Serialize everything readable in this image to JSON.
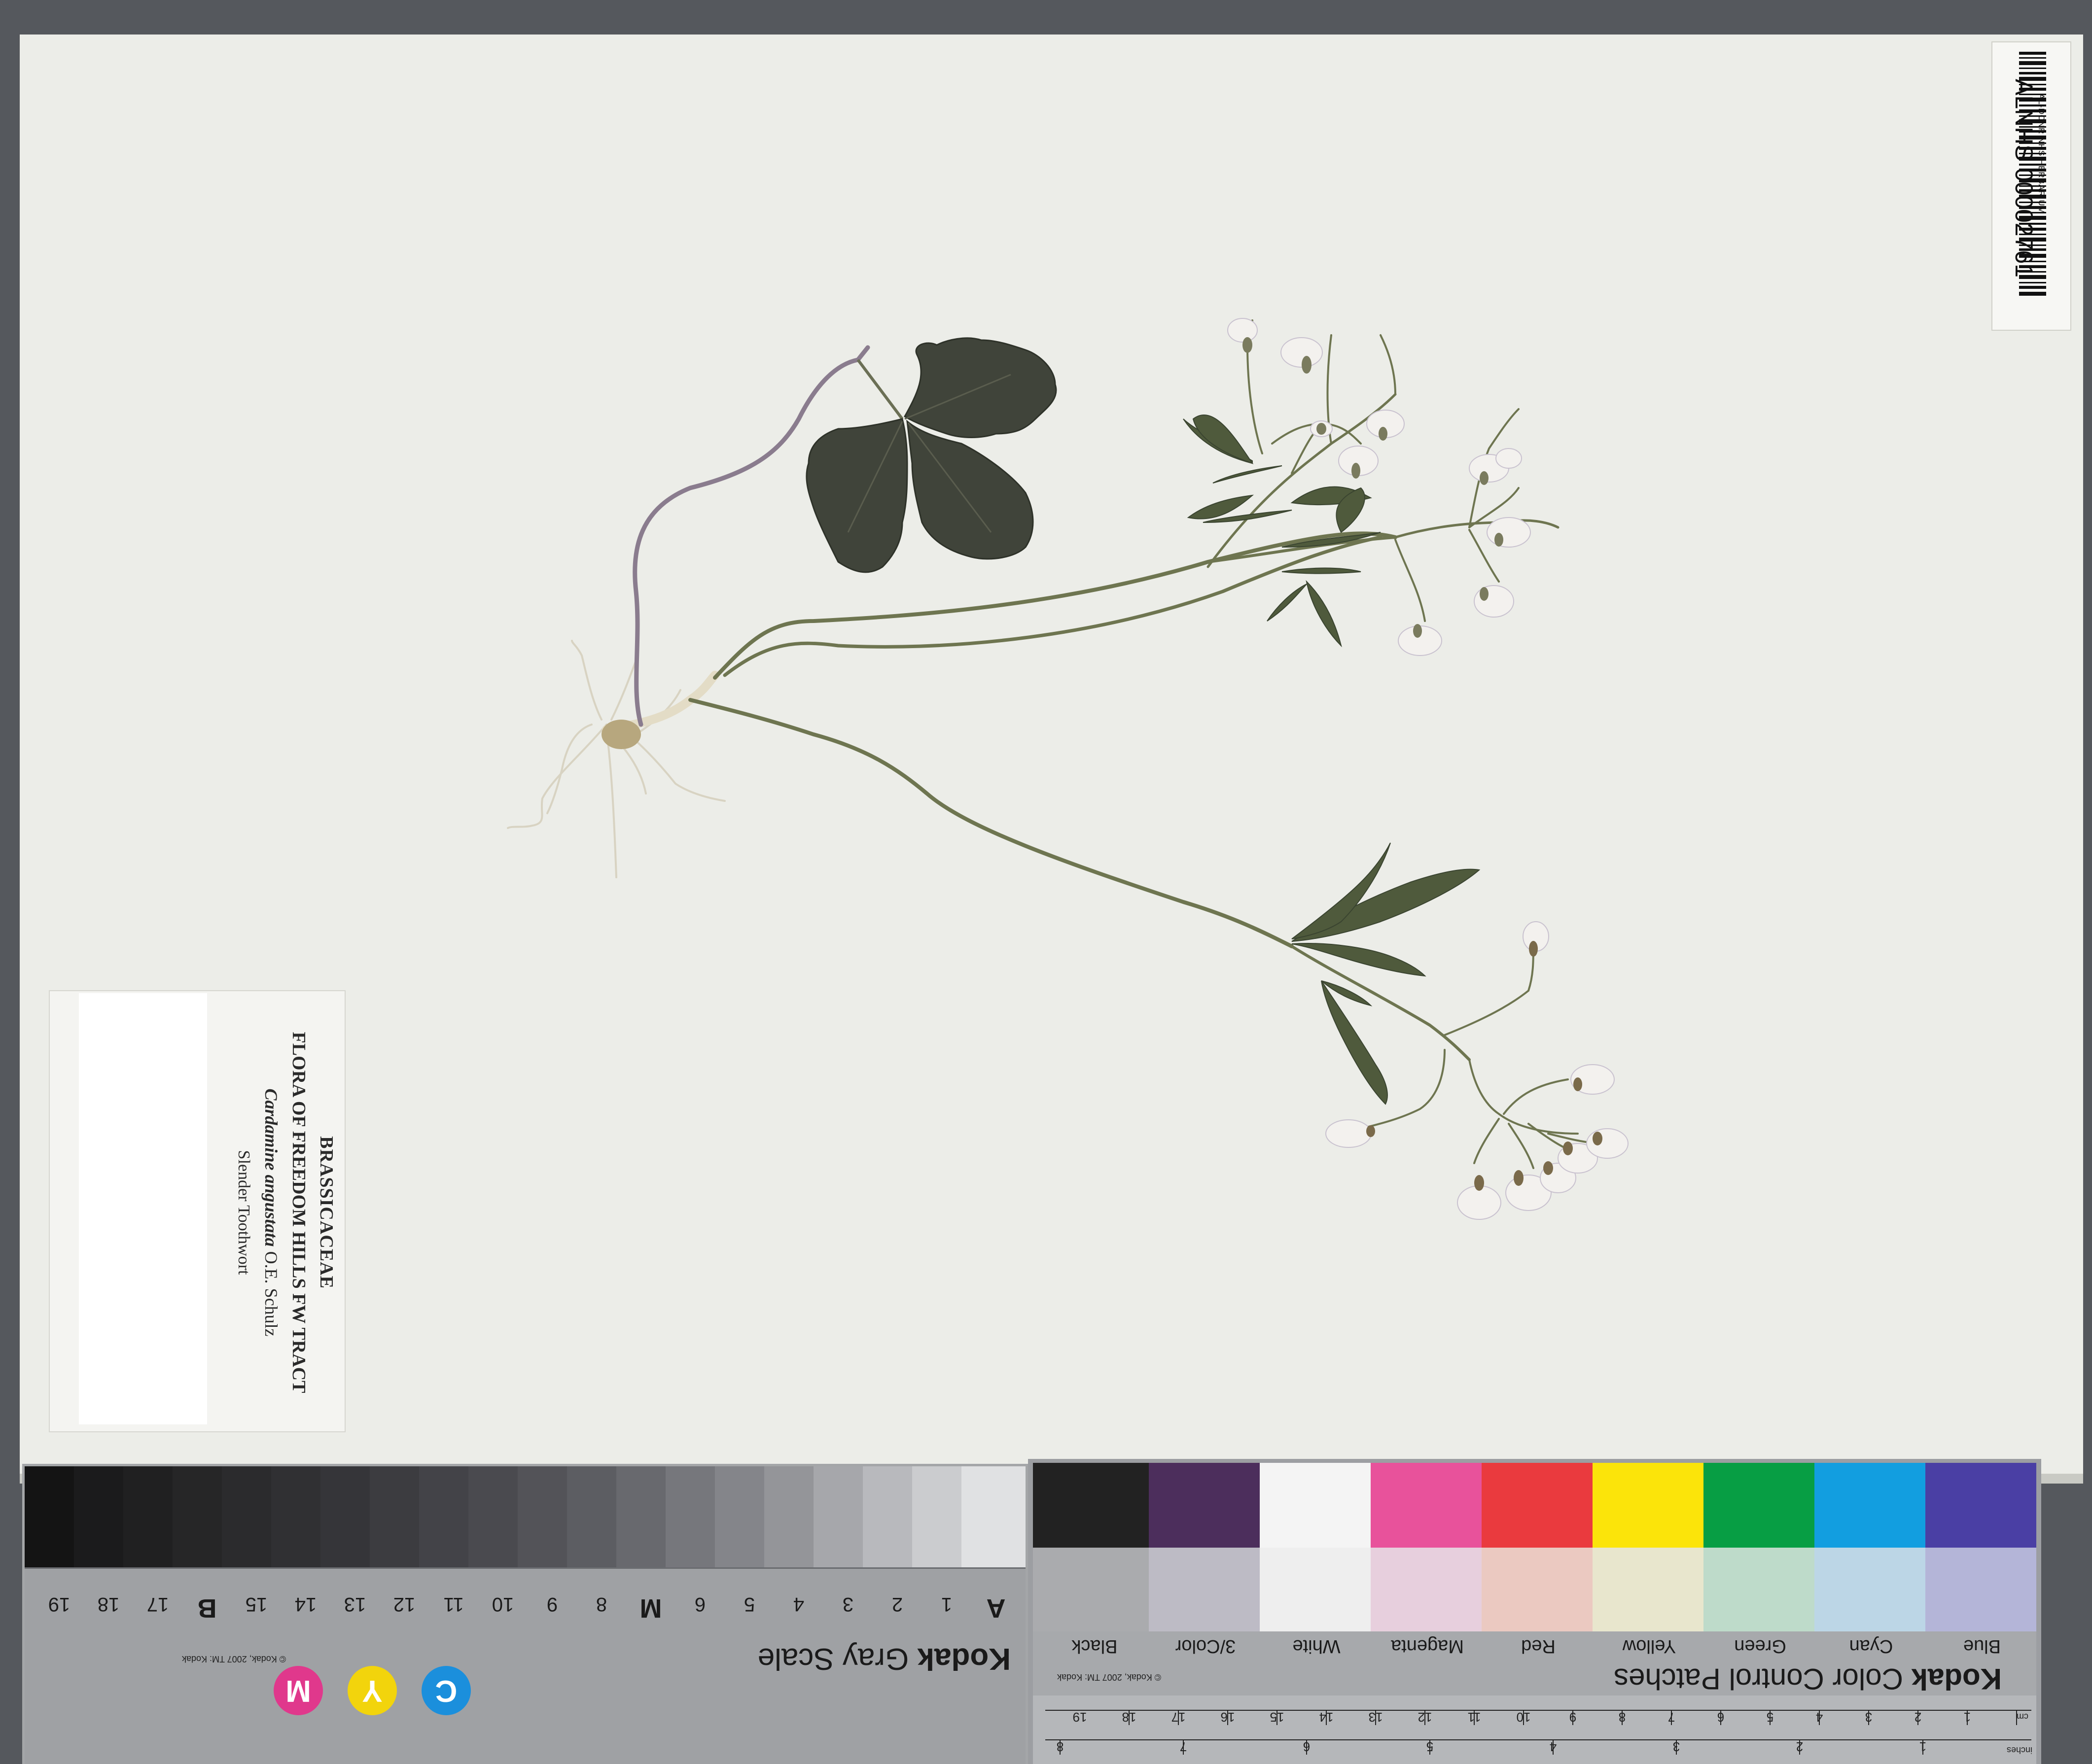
{
  "specimen": {
    "family": "BRASSICACEAE",
    "project": "FLORA OF FREEDOM HILLS FW TRACT",
    "taxon_name": "Cardamine angustata",
    "taxon_author": "O.E. Schulz",
    "common_name": "Slender Toothwort"
  },
  "barcode": {
    "institution": "AL-DCNR NHS HERBARIUM",
    "number": "ALNHS 00002761"
  },
  "gray_scale": {
    "title_brand": "Kodak",
    "title_text": "Gray Scale",
    "copyright": "© Kodak, 2007 TM: Kodak",
    "step_labels": [
      "A",
      "1",
      "2",
      "3",
      "4",
      "5",
      "6",
      "M",
      "8",
      "9",
      "10",
      "11",
      "12",
      "13",
      "14",
      "15",
      "B",
      "17",
      "18",
      "19"
    ],
    "cmy": [
      "C",
      "Y",
      "M"
    ]
  },
  "color_patches": {
    "title_brand": "Kodak",
    "title_text": "Color Control Patches",
    "copyright": "© Kodak, 2007 TM: Kodak",
    "patch_names": [
      "Blue",
      "Cyan",
      "Green",
      "Yellow",
      "Red",
      "Magenta",
      "White",
      "3/Color",
      "Black"
    ],
    "ruler_unit_cm": "cm",
    "ruler_unit_in": "inches",
    "ruler_cm_labels": [
      "1",
      "2",
      "3",
      "4",
      "5",
      "6",
      "7",
      "8",
      "9",
      "10",
      "11",
      "12",
      "13",
      "14",
      "15",
      "16",
      "17",
      "18",
      "19"
    ],
    "ruler_inch_labels": [
      "1",
      "2",
      "3",
      "4",
      "5",
      "6",
      "7",
      "8"
    ]
  },
  "colors": {
    "sheet": "#ecede8",
    "stem": "#6e7550",
    "leaf": "#4f5a3c",
    "basal_leaf": "#3e4235",
    "flower": "#f3f1ee",
    "patch_blue": "#4a3fa4",
    "patch_cyan": "#129ee0",
    "patch_green": "#079e44",
    "patch_yellow": "#fbe40a",
    "patch_red": "#ea3a3e",
    "patch_magenta": "#e85aa6"
  }
}
